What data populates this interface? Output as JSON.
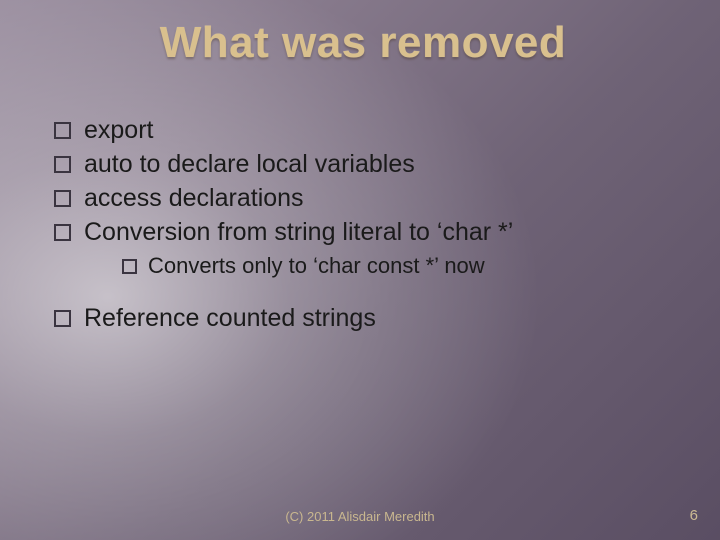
{
  "title": "What was removed",
  "bullets": [
    {
      "text": "export"
    },
    {
      "text": "auto to declare local variables"
    },
    {
      "text": "access declarations"
    },
    {
      "text": "Conversion from string literal to ‘char *’",
      "sub": [
        "Converts only to ‘char const *’ now"
      ]
    },
    {
      "text": "Reference counted strings",
      "gapBefore": true
    }
  ],
  "footer": "(C) 2011 Alisdair Meredith",
  "page": "6"
}
